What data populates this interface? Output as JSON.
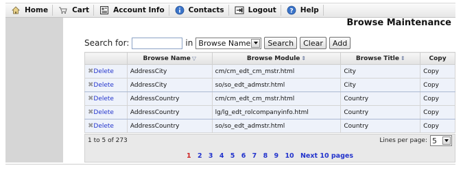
{
  "menu": [
    {
      "label": "Home",
      "icon": "home-icon"
    },
    {
      "label": "Cart",
      "icon": "cart-icon"
    },
    {
      "label": "Account Info",
      "icon": "account-icon"
    },
    {
      "label": "Contacts",
      "icon": "info-icon"
    },
    {
      "label": "Logout",
      "icon": "logout-icon"
    },
    {
      "label": "Help",
      "icon": "help-icon"
    }
  ],
  "page_title": "Browse Maintenance",
  "search": {
    "label": "Search for:",
    "value": "",
    "in_label": "in",
    "selected_field": "Browse Name",
    "search_button": "Search",
    "clear_button": "Clear",
    "add_button": "Add"
  },
  "table": {
    "headers": [
      "",
      "Browse Name",
      "Browse Module",
      "Browse Title",
      "Copy"
    ],
    "rows": [
      {
        "delete": "Delete",
        "name": "AddressCity",
        "module": "cm/cm_edt_cm_mstr.html",
        "title": "City",
        "copy": "Copy"
      },
      {
        "delete": "Delete",
        "name": "AddressCity",
        "module": "so/so_edt_admstr.html",
        "title": "City",
        "copy": "Copy"
      },
      {
        "delete": "Delete",
        "name": "AddressCountry",
        "module": "cm/cm_edt_cm_mstr.html",
        "title": "Country",
        "copy": "Copy"
      },
      {
        "delete": "Delete",
        "name": "AddressCountry",
        "module": "lg/lg_edt_rolcompanyinfo.html",
        "title": "Country",
        "copy": "Copy"
      },
      {
        "delete": "Delete",
        "name": "AddressCountry",
        "module": "so/so_edt_admstr.html",
        "title": "Country",
        "copy": "Copy"
      }
    ]
  },
  "footer": {
    "record_range": "1 to 5 of 273",
    "lines_per_page_label": "Lines per page:",
    "lines_per_page_value": "5",
    "pages": [
      "1",
      "2",
      "3",
      "4",
      "5",
      "6",
      "7",
      "8",
      "9",
      "10"
    ],
    "current_page": "1",
    "next_label": "Next 10 pages"
  },
  "colors": {
    "link": "#2233cc",
    "current_page": "#cc2222",
    "row_bg": "#eef2fa",
    "left_panel": "#d6d6d6"
  }
}
